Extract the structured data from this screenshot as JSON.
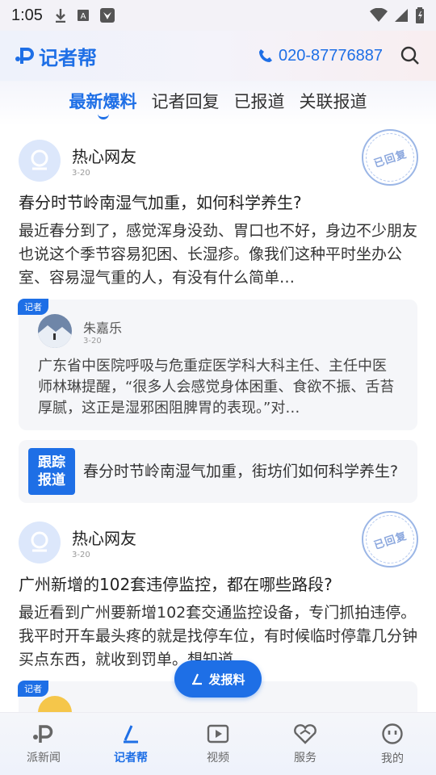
{
  "status_bar": {
    "time": "1:05"
  },
  "header": {
    "logo_text": "记者帮",
    "phone": "020-87776887"
  },
  "tabs": [
    {
      "label": "最新爆料",
      "active": true
    },
    {
      "label": "记者回复",
      "active": false
    },
    {
      "label": "已报道",
      "active": false
    },
    {
      "label": "关联报道",
      "active": false
    }
  ],
  "posts": [
    {
      "user": "热心网友",
      "date": "3-20",
      "stamp": "已回复",
      "title": "春分时节岭南湿气加重，如何科学养生?",
      "body": "最近春分到了，感觉浑身没劲、胃口也不好，身边不少朋友也说这个季节容易犯困、长湿疹。像我们这种平时坐办公室、容易湿气重的人，有没有什么简单…",
      "reply": {
        "tag": "记者",
        "name": "朱嘉乐",
        "date": "3-20",
        "body": "广东省中医院呼吸与危重症医学科大科主任、主任中医师林琳提醒，“很多人会感觉身体困重、食欲不振、舌苔厚腻，这正是湿邪困阻脾胃的表现。”对…"
      },
      "follow": {
        "badge_line1": "跟踪",
        "badge_line2": "报道",
        "text": "春分时节岭南湿气加重，街坊们如何科学养生?"
      }
    },
    {
      "user": "热心网友",
      "date": "3-20",
      "stamp": "已回复",
      "title": "广州新增的102套违停监控，都在哪些路段?",
      "body": "最近看到广州要新增102套交通监控设备，专门抓拍违停。我平时开车最头疼的就是找停车位，有时候临时停靠几分钟买点东西，就收到罚单。想知道…",
      "reply": {
        "tag": "记者"
      }
    }
  ],
  "fab": {
    "label": "发报料"
  },
  "tabbar": [
    {
      "label": "派新闻",
      "icon": "pai-logo-icon",
      "active": false
    },
    {
      "label": "记者帮",
      "icon": "reporter-icon",
      "active": true
    },
    {
      "label": "视频",
      "icon": "video-icon",
      "active": false
    },
    {
      "label": "服务",
      "icon": "service-icon",
      "active": false
    },
    {
      "label": "我的",
      "icon": "profile-icon",
      "active": false
    }
  ],
  "colors": {
    "accent": "#1e6fe6",
    "stamp": "#8ca8de"
  }
}
